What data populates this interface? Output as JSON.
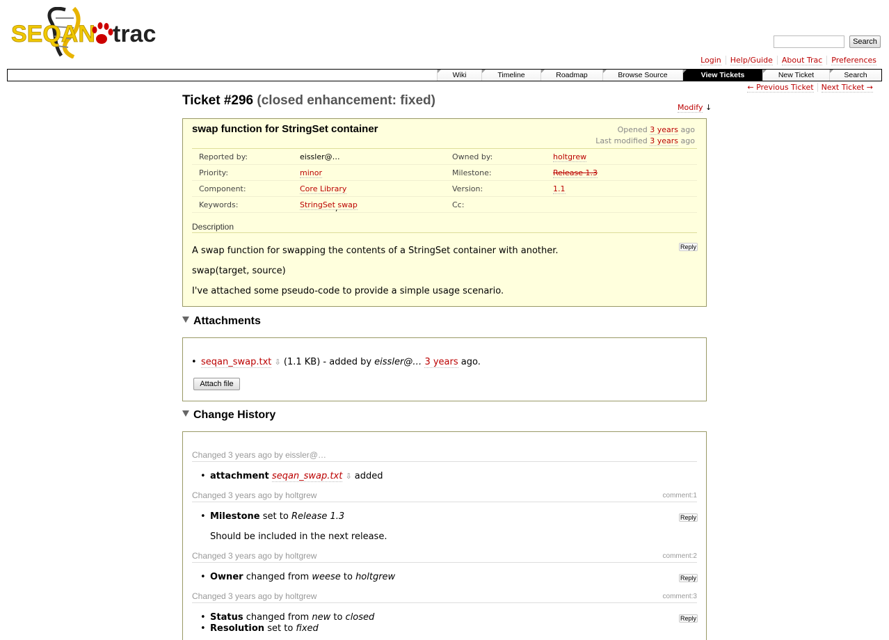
{
  "logo": {
    "left_text": "SEQAN",
    "right_text": "trac"
  },
  "search": {
    "placeholder": "",
    "button": "Search"
  },
  "metanav": [
    "Login",
    "Help/Guide",
    "About Trac",
    "Preferences"
  ],
  "mainnav": [
    {
      "label": "Wiki",
      "active": false
    },
    {
      "label": "Timeline",
      "active": false
    },
    {
      "label": "Roadmap",
      "active": false
    },
    {
      "label": "Browse Source",
      "active": false
    },
    {
      "label": "View Tickets",
      "active": true
    },
    {
      "label": "New Ticket",
      "active": false
    },
    {
      "label": "Search",
      "active": false
    }
  ],
  "ctxtnav": {
    "prev": "← Previous Ticket",
    "next": "Next Ticket →"
  },
  "ticket": {
    "id": "Ticket #296",
    "status": "(closed enhancement: fixed)",
    "modify": "Modify",
    "modify_arrow": "↓",
    "summary": "swap function for StringSet container",
    "opened_label": "Opened",
    "opened_value": "3 years",
    "opened_suffix": "ago",
    "modified_label": "Last modified",
    "modified_value": "3 years",
    "modified_suffix": "ago",
    "props": {
      "reported_by_label": "Reported by:",
      "reported_by": "eissler@…",
      "owned_by_label": "Owned by:",
      "owned_by": "holtgrew",
      "priority_label": "Priority:",
      "priority": "minor",
      "milestone_label": "Milestone:",
      "milestone": "Release 1.3",
      "component_label": "Component:",
      "component": "Core Library",
      "version_label": "Version:",
      "version": "1.1",
      "keywords_label": "Keywords:",
      "keyword1": "StringSet",
      "keyword_sep": ",",
      "keyword2": "swap",
      "cc_label": "Cc:",
      "cc": ""
    },
    "description_heading": "Description",
    "description": [
      "A swap function for swapping the contents of a StringSet container with another.",
      "swap(target, source)",
      "I've attached some pseudo-code to provide a simple usage scenario."
    ],
    "reply": "Reply"
  },
  "attachments": {
    "title": "Attachments",
    "file": "seqan_swap.txt",
    "size": "(1.1 KB) - added by",
    "author": "eissler@…",
    "when": "3 years",
    "suffix": "ago.",
    "attach_button": "Attach file"
  },
  "history": {
    "title": "Change History",
    "changes": [
      {
        "head": "Changed 3 years ago by eissler@…",
        "comment_no": "",
        "field": "attachment",
        "text_pre": "",
        "value": "seqan_swap.txt",
        "text_post": "added"
      },
      {
        "head": "Changed 3 years ago by holtgrew",
        "comment_no": "comment:1",
        "field": "Milestone",
        "text_pre": "set to",
        "value": "Release 1.3",
        "comment": "Should be included in the next release."
      },
      {
        "head": "Changed 3 years ago by holtgrew",
        "comment_no": "comment:2",
        "field": "Owner",
        "text_pre": "changed from",
        "from": "weese",
        "mid": "to",
        "to": "holtgrew"
      },
      {
        "head": "Changed 3 years ago by holtgrew",
        "comment_no": "comment:3",
        "field": "Status",
        "text_pre": "changed from",
        "from": "new",
        "mid": "to",
        "to": "closed",
        "field2": "Resolution",
        "text2": "set to",
        "value2": "fixed"
      }
    ]
  },
  "colors": {
    "link": "#bb0000",
    "ticket_bg": "#ffffdd",
    "active_tab": "#000000"
  }
}
